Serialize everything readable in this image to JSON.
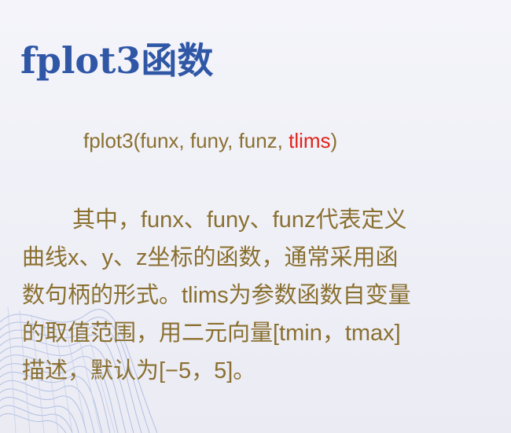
{
  "slide": {
    "title": "fplot3函数",
    "syntax": {
      "prefix": "fplot3(funx, funy, funz, ",
      "highlight": "tlims",
      "suffix": ")"
    },
    "description": "其中，funx、funy、funz代表定义曲线x、y、z坐标的函数，通常采用函数句柄的形式。tlims为参数函数自变量的取值范围，用二元向量[tmin，tmax]描述，默认为[−5，5]。"
  },
  "colors": {
    "title": "#2f57a6",
    "body": "#8a7030",
    "highlight": "#e0241b",
    "decor": "#9fb2dc"
  }
}
